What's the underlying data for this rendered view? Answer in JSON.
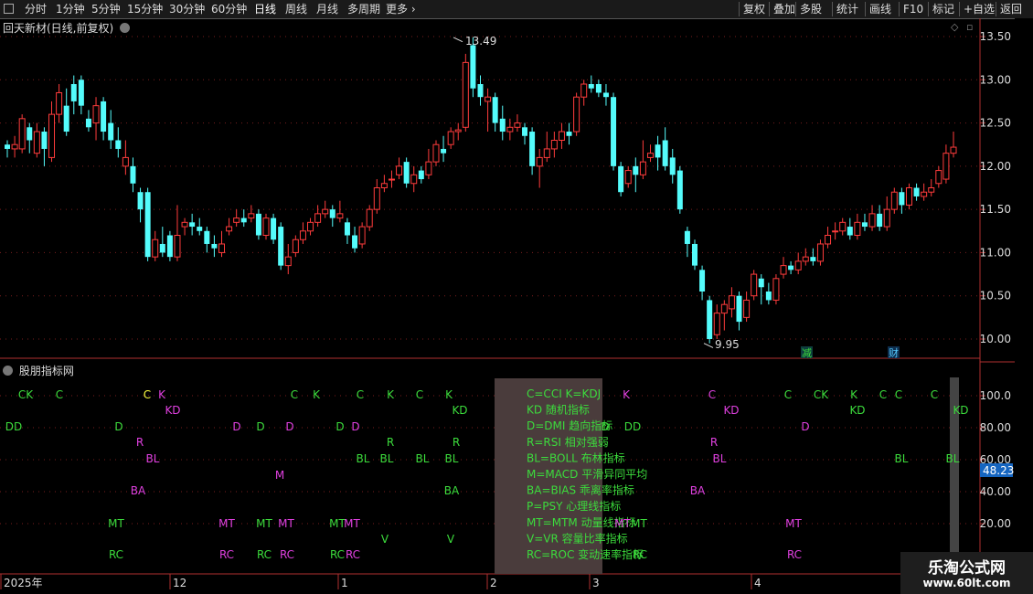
{
  "toolbar": {
    "left": [
      "分时",
      "1分钟",
      "5分钟",
      "15分钟",
      "30分钟",
      "60分钟",
      "日线",
      "周线",
      "月线",
      "多周期",
      "更多"
    ],
    "right": [
      "复权",
      "叠加",
      "多股",
      "统计",
      "画线",
      "F10",
      "标记",
      "+自选",
      "返回"
    ],
    "active": "日线"
  },
  "price_title": "回天新材(日线,前复权)",
  "indicator_title": "股朋指标网",
  "high_label": "13.49",
  "low_label": "9.95",
  "event_markers": [
    "减",
    "财"
  ],
  "price_axis": [
    "13.50",
    "13.00",
    "12.50",
    "12.00",
    "11.50",
    "11.00",
    "10.50",
    "10.00"
  ],
  "ind_axis": [
    "100.0",
    "80.00",
    "60.00",
    "40.00",
    "20.00"
  ],
  "current_value": "48.23",
  "x_axis": [
    "2025年",
    "12",
    "1",
    "2",
    "3",
    "4"
  ],
  "legend": [
    "C=CCI K=KDJ",
    "KD 随机指标",
    "D=DMI 趋向指标",
    "R=RSI 相对强弱",
    "BL=BOLL 布林指标",
    "M=MACD 平滑异同平均",
    "BA=BIAS 乖离率指标",
    "P=PSY 心理线指标",
    "MT=MTM 动量线指标",
    "V=VR 容量比率指标",
    "RC=ROC 变动速率指标"
  ],
  "signals": {
    "row100": [
      [
        "CK",
        28,
        "g"
      ],
      [
        "C",
        65,
        "g"
      ],
      [
        "C",
        161,
        "y"
      ],
      [
        "K",
        177,
        "m"
      ],
      [
        "C",
        322,
        "g"
      ],
      [
        "K",
        346,
        "g"
      ],
      [
        "C",
        394,
        "g"
      ],
      [
        "K",
        427,
        "g"
      ],
      [
        "C",
        459,
        "g"
      ],
      [
        "K",
        491,
        "g"
      ],
      [
        "K",
        685,
        "m"
      ],
      [
        "C",
        779,
        "m"
      ],
      [
        "C",
        862,
        "g"
      ],
      [
        "CK",
        898,
        "g"
      ],
      [
        "K",
        934,
        "g"
      ],
      [
        "C",
        966,
        "g"
      ],
      [
        "C",
        983,
        "g"
      ],
      [
        "C",
        1022,
        "g"
      ]
    ],
    "rowKD": [
      [
        "KD",
        189,
        "m"
      ],
      [
        "KD",
        503,
        "g"
      ],
      [
        "KD",
        800,
        "m"
      ],
      [
        "KD",
        938,
        "g"
      ],
      [
        "KD",
        1051,
        "g"
      ]
    ],
    "rowD": [
      [
        "DD",
        15,
        "g"
      ],
      [
        "D",
        130,
        "g"
      ],
      [
        "D",
        259,
        "m"
      ],
      [
        "D",
        285,
        "g"
      ],
      [
        "D",
        317,
        "m"
      ],
      [
        "D",
        372,
        "g"
      ],
      [
        "D",
        389,
        "m"
      ],
      [
        "D",
        662,
        "g"
      ],
      [
        "DD",
        692,
        "g"
      ],
      [
        "D",
        881,
        "m"
      ]
    ],
    "rowR": [
      [
        "R",
        153,
        "m"
      ],
      [
        "R",
        427,
        "g"
      ],
      [
        "R",
        499,
        "g"
      ],
      [
        "R",
        781,
        "m"
      ]
    ],
    "rowBL": [
      [
        "BL",
        167,
        "m"
      ],
      [
        "BL",
        397,
        "g"
      ],
      [
        "BL",
        423,
        "g"
      ],
      [
        "BL",
        462,
        "g"
      ],
      [
        "BL",
        494,
        "g"
      ],
      [
        "BL",
        787,
        "m"
      ],
      [
        "BL",
        986,
        "g"
      ],
      [
        "BL",
        1042,
        "g"
      ]
    ],
    "rowM": [
      [
        "M",
        306,
        "m"
      ]
    ],
    "rowBA": [
      [
        "BA",
        151,
        "m"
      ],
      [
        "BA",
        494,
        "g"
      ],
      [
        "BA",
        763,
        "m"
      ]
    ],
    "rowMT": [
      [
        "MT",
        127,
        "g"
      ],
      [
        "MT",
        248,
        "m"
      ],
      [
        "MT",
        289,
        "g"
      ],
      [
        "MT",
        313,
        "m"
      ],
      [
        "MT",
        369,
        "g"
      ],
      [
        "MT",
        385,
        "m"
      ],
      [
        "MT",
        681,
        "m"
      ],
      [
        "MT",
        699,
        "g"
      ],
      [
        "MT",
        868,
        "m"
      ]
    ],
    "rowV": [
      [
        "V",
        421,
        "g"
      ],
      [
        "V",
        493,
        "g"
      ]
    ],
    "rowRC": [
      [
        "RC",
        127,
        "g"
      ],
      [
        "RC",
        248,
        "m"
      ],
      [
        "RC",
        289,
        "g"
      ],
      [
        "RC",
        314,
        "m"
      ],
      [
        "RC",
        369,
        "g"
      ],
      [
        "RC",
        386,
        "m"
      ],
      [
        "RC",
        700,
        "g"
      ],
      [
        "RC",
        869,
        "m"
      ]
    ]
  },
  "colors": {
    "up": "#ff3c3c",
    "down": "#54fcfc",
    "green": "#3cdc3c",
    "magenta": "#e040e0",
    "yellow": "#ffff40",
    "axis": "#b03030"
  },
  "watermark": {
    "line1": "乐淘公式网",
    "line2": "www.60lt.com"
  }
}
